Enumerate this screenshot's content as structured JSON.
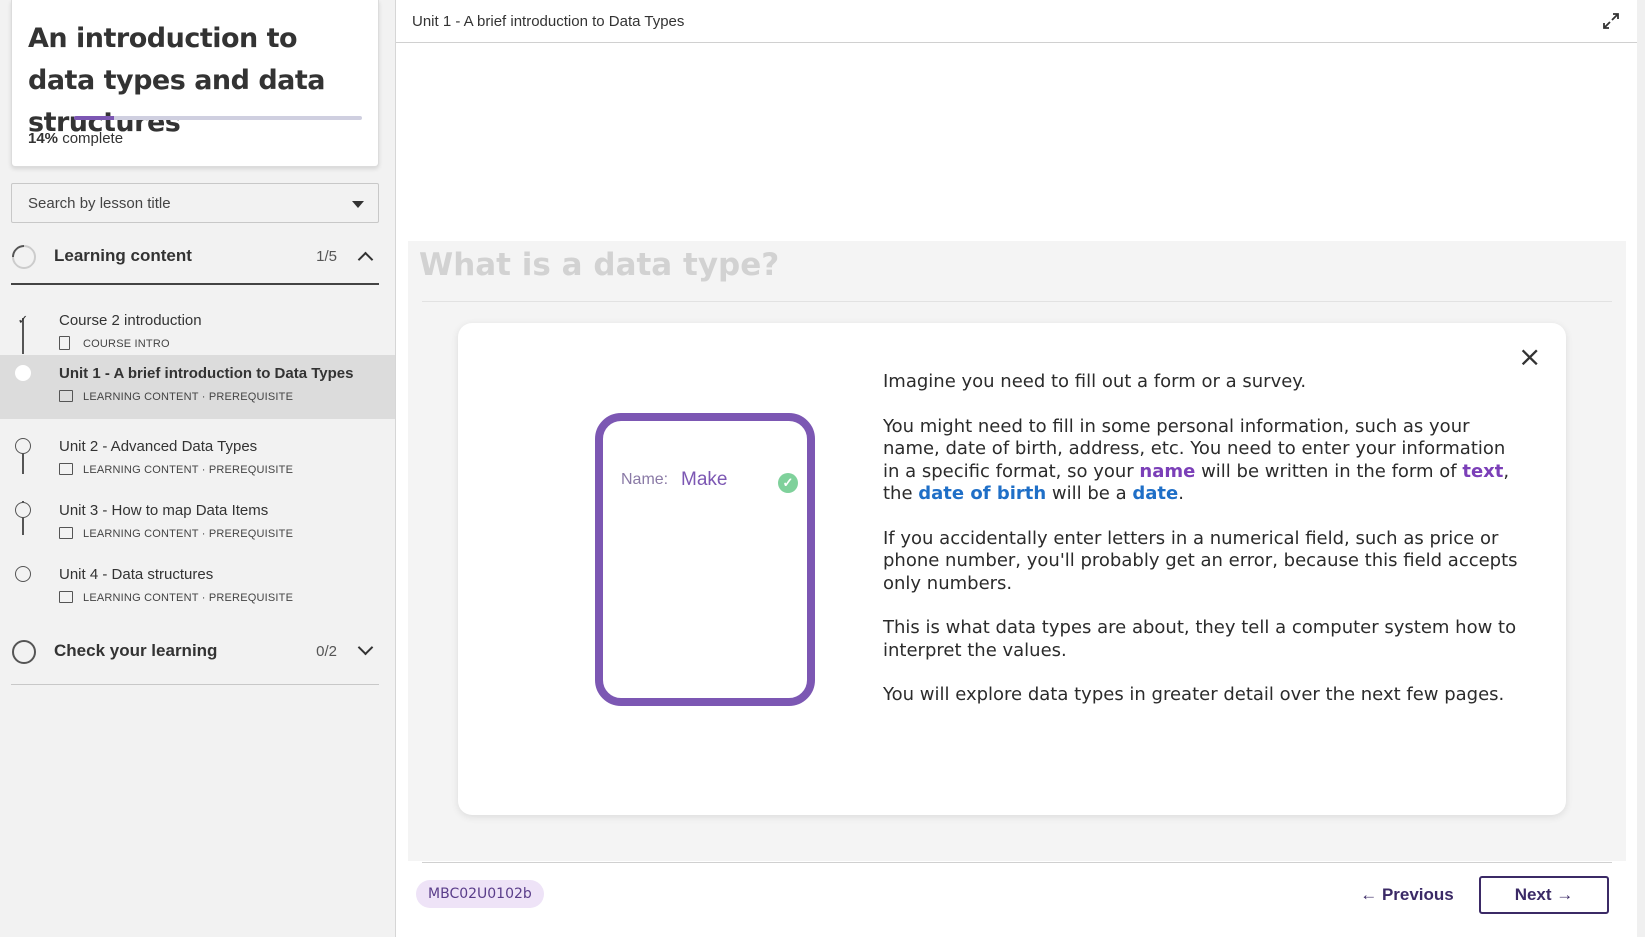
{
  "course": {
    "title": "An introduction to data types and data structures",
    "progress_percent": 14,
    "progress_pct_label": "14%",
    "progress_suffix": " complete"
  },
  "search": {
    "placeholder": "Search by lesson title"
  },
  "sections": [
    {
      "title": "Learning content",
      "count": "1/5",
      "expanded": true,
      "lessons": [
        {
          "title": "Course 2 introduction",
          "meta": "COURSE INTRO",
          "status": "done",
          "icon": "document-icon"
        },
        {
          "title": "Unit 1 - A brief introduction to Data Types",
          "meta": "LEARNING CONTENT · PREREQUISITE",
          "status": "current",
          "icon": "slides-icon"
        },
        {
          "title": "Unit 2 - Advanced Data Types",
          "meta": "LEARNING CONTENT · PREREQUISITE",
          "status": "not-started",
          "icon": "slides-icon"
        },
        {
          "title": "Unit 3 - How to map Data Items",
          "meta": "LEARNING CONTENT · PREREQUISITE",
          "status": "not-started",
          "icon": "slides-icon"
        },
        {
          "title": "Unit 4 - Data structures",
          "meta": "LEARNING CONTENT · PREREQUISITE",
          "status": "not-started",
          "icon": "slides-icon"
        }
      ]
    },
    {
      "title": "Check your learning",
      "count": "0/2",
      "expanded": false
    }
  ],
  "header": {
    "breadcrumb": "Unit 1 - A brief introduction to Data Types",
    "expand_icon": "expand-icon"
  },
  "slide": {
    "ghost_title": "What is a data type?",
    "close_icon": "close-icon",
    "illustration": {
      "field_label": "Name:",
      "field_value": "Make",
      "check_icon": "check-icon"
    },
    "paragraphs": {
      "p1": "Imagine you need to fill out a form or a survey.",
      "p2a": "You might need to fill in some personal information, such as your name, date of birth, address, etc. You need to enter your information in a specific format, so your ",
      "p2_name": "name",
      "p2b": " will be written in the form of ",
      "p2_text": "text",
      "p2c": ", the ",
      "p2_dob": "date of birth",
      "p2d": " will be a ",
      "p2_date": "date",
      "p2e": ".",
      "p3": "If you accidentally enter letters in a numerical field, such as price or phone number, you'll probably get an error, because this field accepts only numbers.",
      "p4": "This is what data types are about, they tell a computer system how to interpret the values.",
      "p5": "You will explore data types in greater detail over the next few pages."
    }
  },
  "footer": {
    "code": "MBC02U0102b",
    "previous": "← Previous",
    "next": "Next →"
  },
  "colors": {
    "accent_purple": "#7c57b3",
    "highlight_purple": "#7b3fb8",
    "highlight_blue": "#1f6fc7",
    "check_green": "#7fd19b"
  }
}
